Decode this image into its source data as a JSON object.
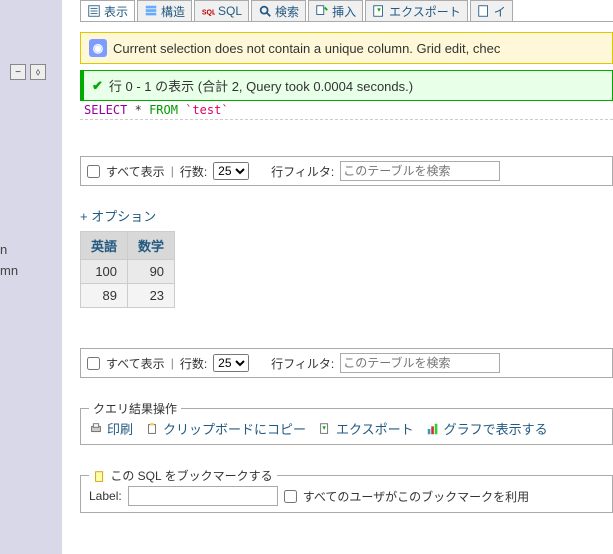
{
  "sidebar": {
    "text1": "n",
    "text2": "mn"
  },
  "tabs": [
    {
      "label": "表示",
      "icon": "list"
    },
    {
      "label": "構造",
      "icon": "structure"
    },
    {
      "label": "SQL",
      "icon": "sql"
    },
    {
      "label": "検索",
      "icon": "search"
    },
    {
      "label": "挿入",
      "icon": "insert"
    },
    {
      "label": "エクスポート",
      "icon": "export"
    },
    {
      "label": "イ",
      "icon": "import"
    }
  ],
  "warning": {
    "text": "Current selection does not contain a unique column. Grid edit, chec"
  },
  "success": {
    "text": "行 0 - 1 の表示 (合計 2, Query took 0.0004 seconds.)"
  },
  "sql": {
    "select": "SELECT",
    "star": "*",
    "from": "FROM",
    "table": "`test`"
  },
  "controls": {
    "show_all": "すべて表示",
    "rows_label": "行数:",
    "rows_value": "25",
    "filter_label": "行フィルタ:",
    "filter_placeholder": "このテーブルを検索"
  },
  "options_link": "+ オプション",
  "table": {
    "headers": [
      "英語",
      "数学"
    ],
    "rows": [
      [
        "100",
        "90"
      ],
      [
        "89",
        "23"
      ]
    ]
  },
  "query_ops": {
    "legend": "クエリ結果操作",
    "print": "印刷",
    "copy": "クリップボードにコピー",
    "export": "エクスポート",
    "chart": "グラフで表示する"
  },
  "bookmark": {
    "legend": "この SQL をブックマークする",
    "label": "Label:",
    "all_users": "すべてのユーザがこのブックマークを利用"
  }
}
